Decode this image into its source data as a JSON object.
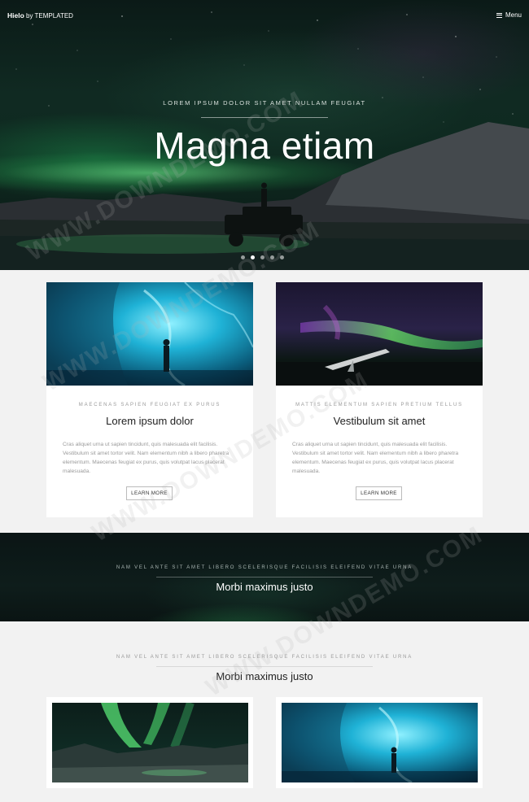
{
  "header": {
    "brand_name": "Hielo",
    "brand_by": "by TEMPLATED",
    "menu_label": "Menu"
  },
  "hero": {
    "subtitle": "LOREM IPSUM DOLOR SIT AMET NULLAM FEUGIAT",
    "title": "Magna etiam",
    "slides": 5,
    "active_slide": 2
  },
  "cards": [
    {
      "meta": "MAECENAS SAPIEN FEUGIAT EX PURUS",
      "title": "Lorem ipsum dolor",
      "body": "Cras aliquet urna ut sapien tincidunt, quis malesuada elit facilisis. Vestibulum sit amet tortor velit. Nam elementum nibh a libero pharetra elementum. Maecenas feugiat ex purus, quis volutpat lacus placerat malesuada.",
      "button": "LEARN MORE"
    },
    {
      "meta": "MATTIS ELEMENTUM SAPIEN PRETIUM TELLUS",
      "title": "Vestibulum sit amet",
      "body": "Cras aliquet urna ut sapien tincidunt, quis malesuada elit facilisis. Vestibulum sit amet tortor velit. Nam elementum nibh a libero pharetra elementum. Maecenas feugiat ex purus, quis volutpat lacus placerat malesuada.",
      "button": "LEARN MORE"
    }
  ],
  "banner": {
    "subtitle": "NAM VEL ANTE SIT AMET LIBERO SCELERISQUE FACILISIS ELEIFEND VITAE URNA",
    "title": "Morbi maximus justo"
  },
  "section2": {
    "subtitle": "NAM VEL ANTE SIT AMET LIBERO SCELERISQUE FACILISIS ELEIFEND VITAE URNA",
    "title": "Morbi maximus justo"
  },
  "watermark": "WWW.DOWNDEMO.COM"
}
